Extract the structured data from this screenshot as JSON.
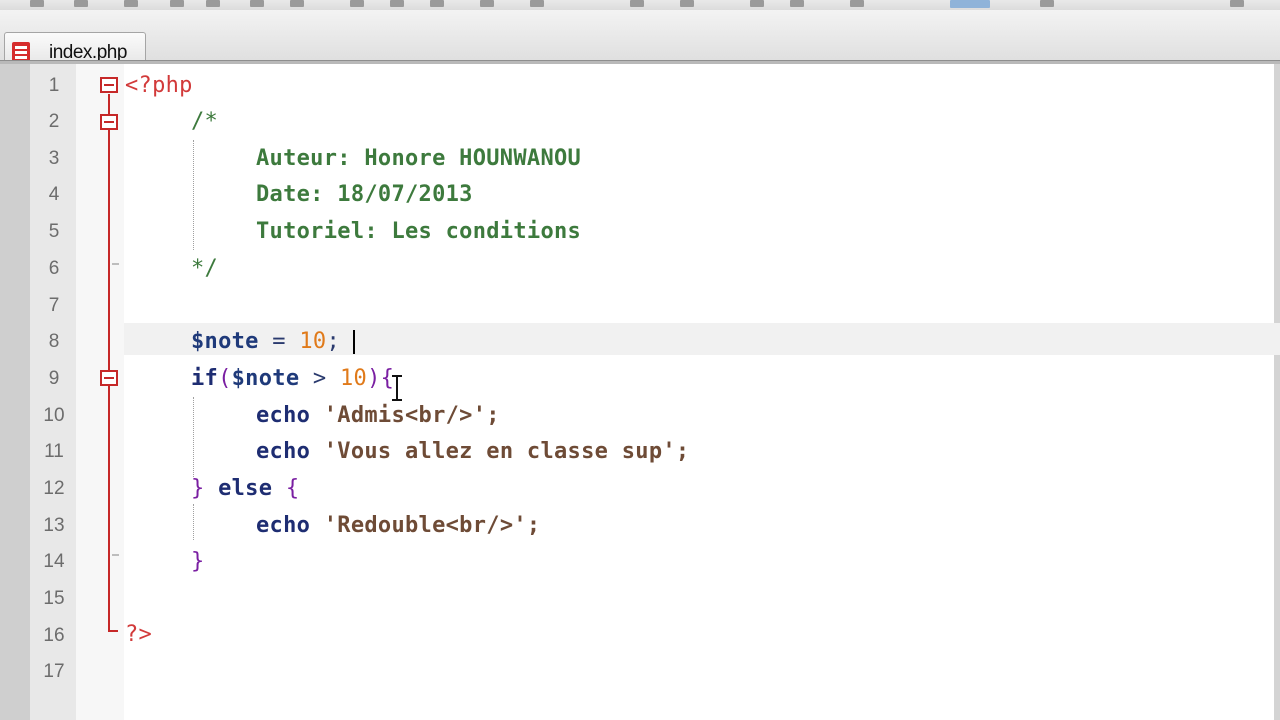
{
  "tab": {
    "label": "index.php",
    "icon": "php-file-icon"
  },
  "line_numbers": [
    "1",
    "2",
    "3",
    "4",
    "5",
    "6",
    "7",
    "8",
    "9",
    "10",
    "11",
    "12",
    "13",
    "14",
    "15",
    "16",
    "17"
  ],
  "code": {
    "l1": "<?php",
    "l2": "/*",
    "l3": "Auteur: Honore HOUNWANOU",
    "l4": "Date: 18/07/2013",
    "l5": "Tutoriel: Les conditions",
    "l6": "*/",
    "l8_var": "$note",
    "l8_op": " = ",
    "l8_num": "10",
    "l8_end": ";",
    "l9_if": "if",
    "l9_open": "(",
    "l9_var": "$note",
    "l9_op": " > ",
    "l9_num": "10",
    "l9_close": "){",
    "l10_echo": "echo",
    "l10_str": " 'Admis<br/>';",
    "l11_echo": "echo",
    "l11_str": " 'Vous allez en classe sup';",
    "l12_brace": "}",
    "l12_else": " else ",
    "l12_open": "{",
    "l13_echo": "echo",
    "l13_str": " 'Redouble<br/>';",
    "l14": "}",
    "l16": "?>"
  },
  "colors": {
    "php_tag": "#d23a3a",
    "comment": "#3d7a3d",
    "variable": "#1f3a7a",
    "number": "#e07a1a",
    "keyword": "#1e2d72",
    "string": "#6e4b36",
    "bracket": "#7a1fa2",
    "fold_marker": "#c62828",
    "current_line": "#f1f1f1"
  }
}
